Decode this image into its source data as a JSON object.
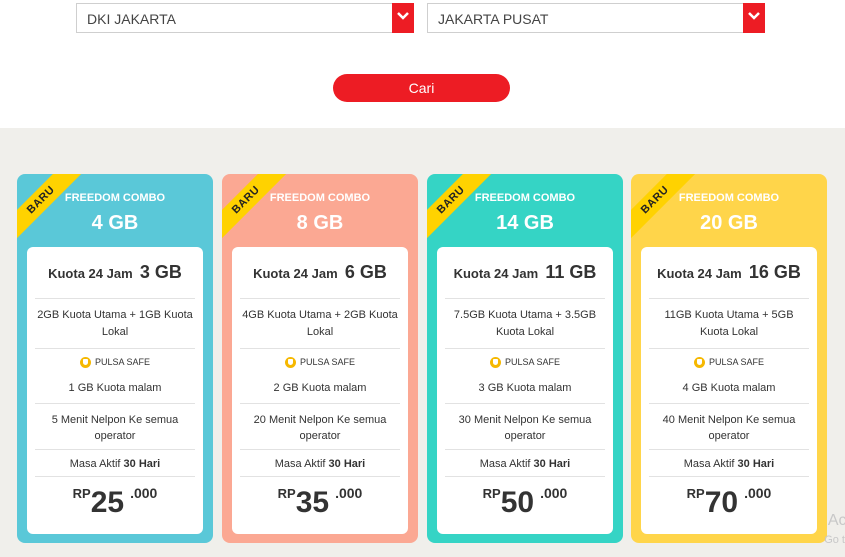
{
  "filters": {
    "province": "DKI JAKARTA",
    "city": "JAKARTA PUSAT",
    "search_label": "Cari"
  },
  "colors": {
    "accent": "#ed1c24",
    "ribbon": "#ffd200"
  },
  "cards": [
    {
      "ribbon": "BARU",
      "title": "FREEDOM COMBO",
      "size": "4 GB",
      "color": "#5ac8d8",
      "kuota_label": "Kuota 24 Jam",
      "kuota_value": "3 GB",
      "main": "2GB Kuota Utama + 1GB Kuota Lokal",
      "pulsa": "PULSA SAFE",
      "malam": "1 GB Kuota malam",
      "nelpon": "5 Menit Nelpon Ke semua operator",
      "aktif_label": "Masa Aktif",
      "aktif_value": "30 Hari",
      "price_rp": "RP",
      "price_main": "25",
      "price_dec": ".000"
    },
    {
      "ribbon": "BARU",
      "title": "FREEDOM COMBO",
      "size": "8 GB",
      "color": "#fba893",
      "kuota_label": "Kuota 24 Jam",
      "kuota_value": "6 GB",
      "main": "4GB Kuota Utama + 2GB Kuota Lokal",
      "pulsa": "PULSA SAFE",
      "malam": "2 GB Kuota malam",
      "nelpon": "20 Menit Nelpon Ke semua operator",
      "aktif_label": "Masa Aktif",
      "aktif_value": "30 Hari",
      "price_rp": "RP",
      "price_main": "35",
      "price_dec": ".000"
    },
    {
      "ribbon": "BARU",
      "title": "FREEDOM COMBO",
      "size": "14 GB",
      "color": "#35d4c5",
      "kuota_label": "Kuota 24 Jam",
      "kuota_value": "11 GB",
      "main": "7.5GB Kuota Utama + 3.5GB Kuota Lokal",
      "pulsa": "PULSA SAFE",
      "malam": "3 GB Kuota malam",
      "nelpon": "30 Menit Nelpon Ke semua operator",
      "aktif_label": "Masa Aktif",
      "aktif_value": "30 Hari",
      "price_rp": "RP",
      "price_main": "50",
      "price_dec": ".000"
    },
    {
      "ribbon": "BARU",
      "title": "FREEDOM COMBO",
      "size": "20 GB",
      "color": "#ffd54a",
      "kuota_label": "Kuota 24 Jam",
      "kuota_value": "16 GB",
      "main": "11GB Kuota Utama + 5GB Kuota Lokal",
      "pulsa": "PULSA SAFE",
      "malam": "4 GB Kuota malam",
      "nelpon": "40 Menit Nelpon Ke semua operator",
      "aktif_label": "Masa Aktif",
      "aktif_value": "30 Hari",
      "price_rp": "RP",
      "price_main": "70",
      "price_dec": ".000"
    }
  ],
  "watermark": {
    "line1": "Act",
    "line2": "Go t"
  }
}
